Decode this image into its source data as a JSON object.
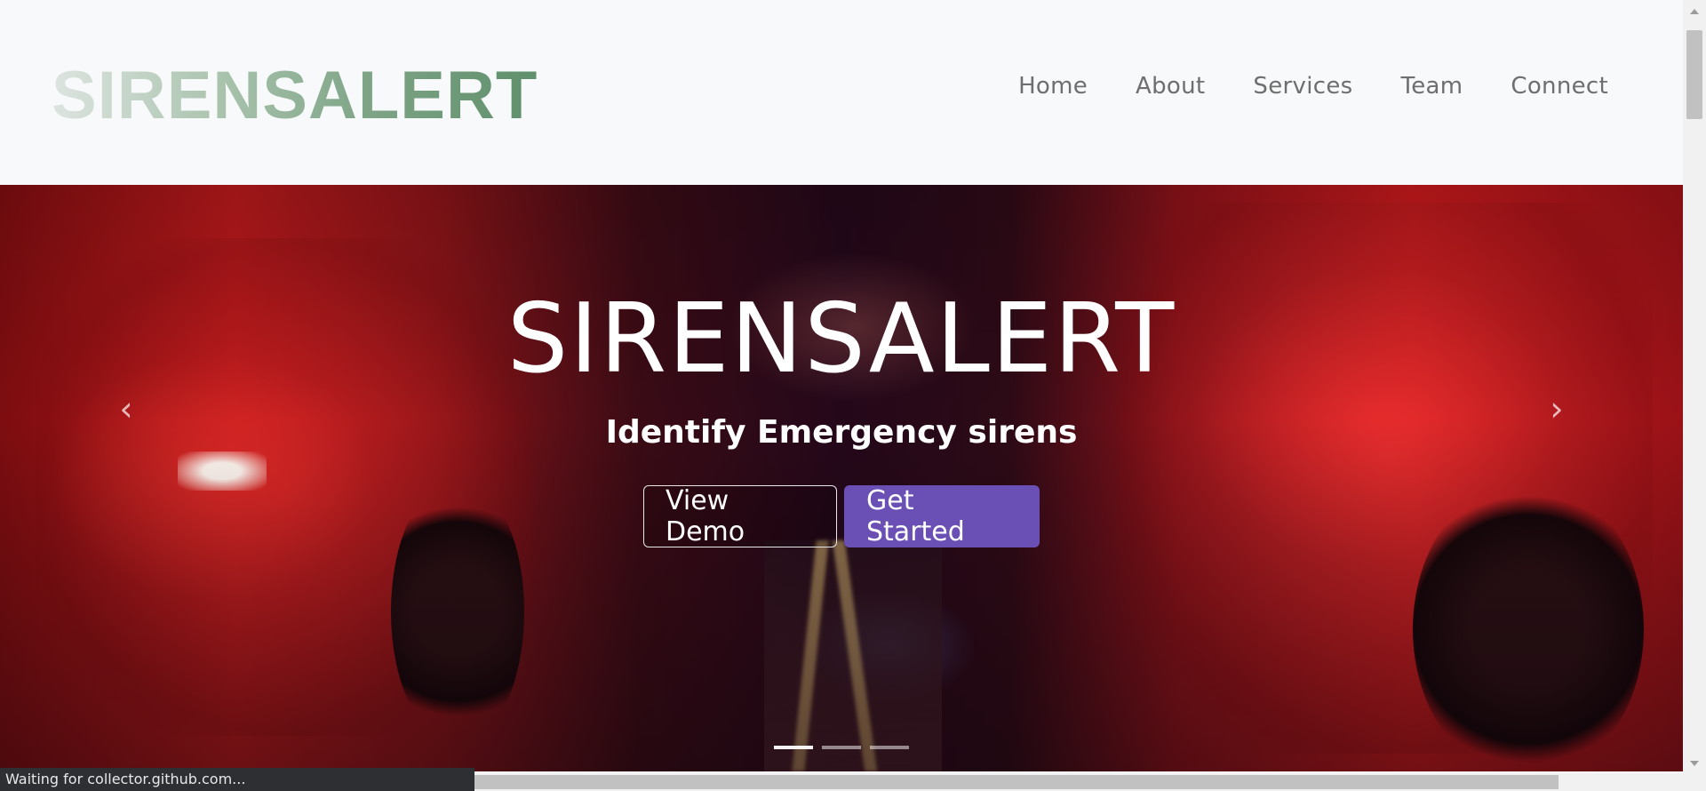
{
  "header": {
    "brand": "SIRENSALERT",
    "nav": [
      {
        "label": "Home"
      },
      {
        "label": "About"
      },
      {
        "label": "Services"
      },
      {
        "label": "Team"
      },
      {
        "label": "Connect"
      }
    ]
  },
  "hero": {
    "title": "SIRENSALERT",
    "subtitle": "Identify Emergency sirens",
    "view_demo_label": "View Demo",
    "get_started_label": "Get Started",
    "prev_icon": "‹",
    "next_icon": "›",
    "active_slide": 1,
    "slide_count": 3
  },
  "status_bar": {
    "text": "Waiting for collector.github.com..."
  },
  "colors": {
    "brand_gradient_start": "#dde4e0",
    "brand_gradient_end": "#5f8f6b",
    "get_started_bg": "#6a4fb5",
    "nav_text": "#6e6e6e"
  }
}
